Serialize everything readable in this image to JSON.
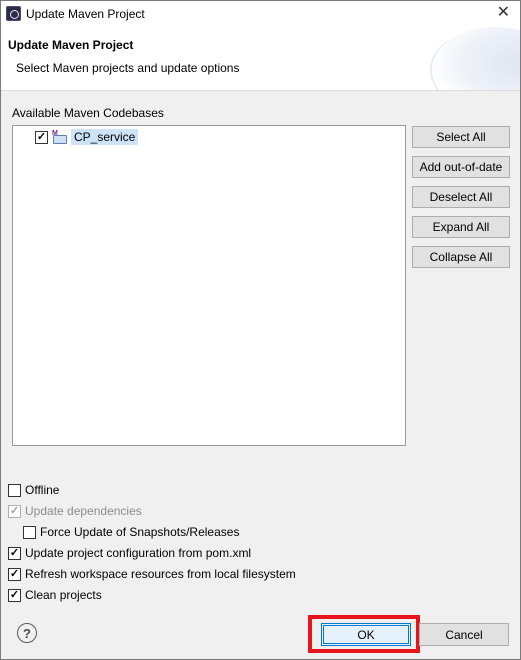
{
  "window": {
    "title": "Update Maven Project"
  },
  "banner": {
    "title": "Update Maven Project",
    "description": "Select Maven projects and update options"
  },
  "codebases": {
    "label": "Available Maven Codebases",
    "items": [
      {
        "label": "CP_service",
        "checked": true
      }
    ]
  },
  "side_buttons": {
    "select_all": "Select All",
    "add_out_of_date": "Add out-of-date",
    "deselect_all": "Deselect All",
    "expand_all": "Expand All",
    "collapse_all": "Collapse All"
  },
  "options": {
    "offline": {
      "label": "Offline",
      "checked": false
    },
    "update_dependencies": {
      "label": "Update dependencies",
      "checked": true,
      "disabled": true
    },
    "force_update": {
      "label": "Force Update of Snapshots/Releases",
      "checked": false
    },
    "update_config": {
      "label": "Update project configuration from pom.xml",
      "checked": true
    },
    "refresh_workspace": {
      "label": "Refresh workspace resources from local filesystem",
      "checked": true
    },
    "clean_projects": {
      "label": "Clean projects",
      "checked": true
    }
  },
  "footer": {
    "help_icon": "?",
    "ok": "OK",
    "cancel": "Cancel"
  },
  "colors": {
    "highlight": "#e8141b",
    "selection": "#cde3f7",
    "focus": "#0078d7"
  }
}
